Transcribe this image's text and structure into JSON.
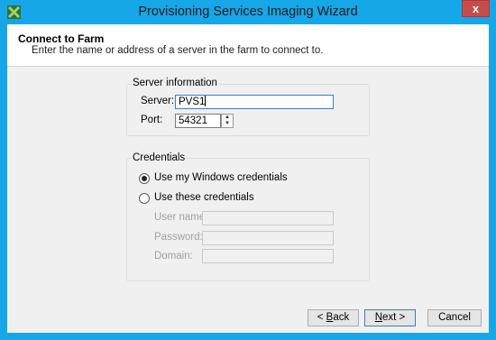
{
  "window": {
    "title": "Provisioning Services Imaging Wizard",
    "close_glyph": "x"
  },
  "header": {
    "title": "Connect to Farm",
    "subtitle": "Enter the name or address of a server in the farm to connect to."
  },
  "server_group": {
    "label": "Server information",
    "server_label": "Server:",
    "server_value": "PVS1",
    "port_label": "Port:",
    "port_value": "54321",
    "spin_up": "▲",
    "spin_down": "▼"
  },
  "credentials": {
    "label": "Credentials",
    "selected_option": "windows",
    "option_windows": "Use my Windows credentials",
    "option_these": "Use these credentials",
    "username_label": "User name:",
    "password_label": "Password:",
    "domain_label": "Domain:",
    "username_value": "",
    "password_value": "",
    "domain_value": ""
  },
  "buttons": {
    "back_mnemonic": "< ",
    "back_key": "B",
    "back_rest": "ack",
    "next_key": "N",
    "next_rest": "ext >",
    "cancel": "Cancel"
  },
  "colors": {
    "window_frame": "#16a7e8",
    "close_button": "#c74d4d"
  }
}
